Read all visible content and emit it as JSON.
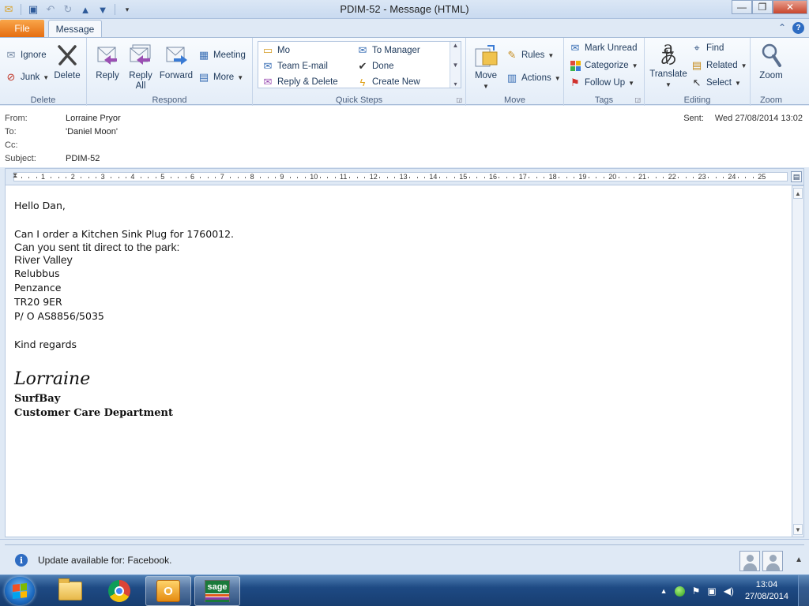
{
  "window": {
    "title": "PDIM-52  -  Message (HTML)",
    "controls": {
      "minimize": "—",
      "maximize": "❐",
      "close": "✕"
    }
  },
  "tabs": {
    "file": "File",
    "message": "Message"
  },
  "ribbon": {
    "delete_group": {
      "label": "Delete",
      "ignore": "Ignore",
      "junk": "Junk",
      "delete": "Delete"
    },
    "respond_group": {
      "label": "Respond",
      "reply": "Reply",
      "reply_all_line1": "Reply",
      "reply_all_line2": "All",
      "forward": "Forward",
      "meeting": "Meeting",
      "more": "More"
    },
    "quick_steps": {
      "label": "Quick Steps",
      "items": [
        "Mo",
        "To Manager",
        "Team E-mail",
        "Done",
        "Reply & Delete",
        "Create New"
      ]
    },
    "move_group": {
      "label": "Move",
      "move": "Move",
      "rules": "Rules",
      "actions": "Actions"
    },
    "tags_group": {
      "label": "Tags",
      "mark_unread": "Mark Unread",
      "categorize": "Categorize",
      "follow_up": "Follow Up"
    },
    "editing_group": {
      "label": "Editing",
      "translate": "Translate",
      "find": "Find",
      "related": "Related",
      "select": "Select"
    },
    "zoom_group": {
      "label": "Zoom",
      "zoom": "Zoom"
    }
  },
  "header": {
    "from_label": "From:",
    "from": "Lorraine Pryor",
    "to_label": "To:",
    "to": "'Daniel Moon'",
    "cc_label": "Cc:",
    "cc": "",
    "subject_label": "Subject:",
    "subject": "PDIM-52",
    "sent_label": "Sent:",
    "sent": "Wed 27/08/2014 13:02"
  },
  "ruler": {
    "numbers": [
      "1",
      "2",
      "3",
      "4",
      "5",
      "6",
      "7",
      "8",
      "9",
      "10",
      "11",
      "12",
      "13",
      "14",
      "15",
      "16",
      "17",
      "18",
      "19",
      "20",
      "21",
      "22",
      "23",
      "24",
      "25"
    ]
  },
  "body": {
    "greeting": "Hello Dan,",
    "line1": "Can I order a Kitchen Sink Plug for 1760012.",
    "line2": "Can you sent tit direct to the park:",
    "line3": "River Valley",
    "line4": "Relubbus",
    "line5": "Penzance",
    "line6": "TR20 9ER",
    "line7": "P/ O AS8856/5035",
    "closing": "Kind regards",
    "signature_name": "Lorraine",
    "signature_company": "SurfBay",
    "signature_dept": "Customer Care Department"
  },
  "infobar": {
    "text": "Update available for: Facebook."
  },
  "taskbar": {
    "time": "13:04",
    "date": "27/08/2014",
    "sage": "sage"
  }
}
